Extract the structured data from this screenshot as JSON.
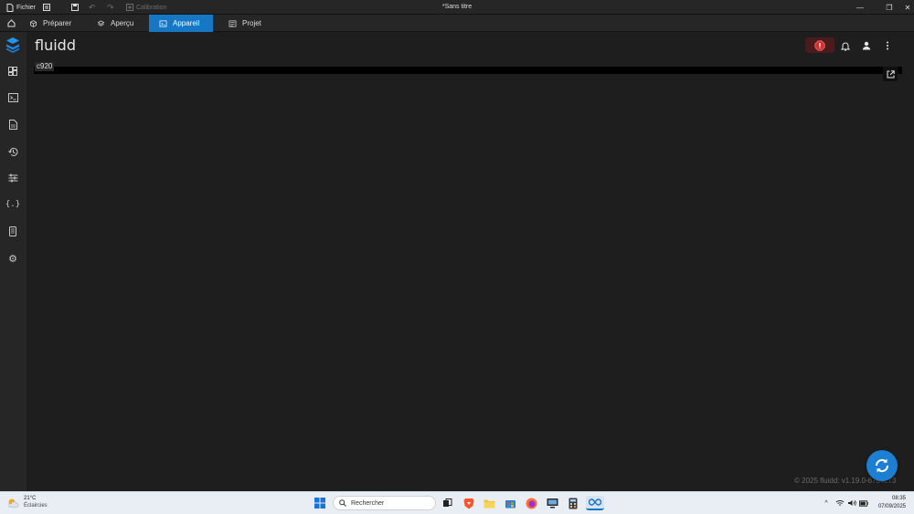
{
  "titlebar": {
    "file_label": "Fichier",
    "calibration_label": "Calibration",
    "window_title": "*Sans titre"
  },
  "tabs": [
    {
      "label": "Préparer",
      "icon": "cube-icon"
    },
    {
      "label": "Aperçu",
      "icon": "layers-icon"
    },
    {
      "label": "Appareil",
      "icon": "device-icon",
      "active": true
    },
    {
      "label": "Projet",
      "icon": "project-icon"
    }
  ],
  "app": {
    "brand": "fluidd",
    "camera_label": "c920",
    "footer": "© 2025 fluidd: v1.19.0-6784c73",
    "accent_color": "#1677c5",
    "estop_color": "#d32f2f"
  },
  "sidebar": {
    "items": [
      "dashboard-icon",
      "console-icon",
      "files-icon",
      "history-icon",
      "tune-icon",
      "macros-icon",
      "system-icon",
      "settings-icon"
    ]
  },
  "taskbar": {
    "weather_temp": "21°C",
    "weather_desc": "Éclaircies",
    "search_placeholder": "Rechercher",
    "time": "08:35",
    "date": "07/09/2025"
  }
}
